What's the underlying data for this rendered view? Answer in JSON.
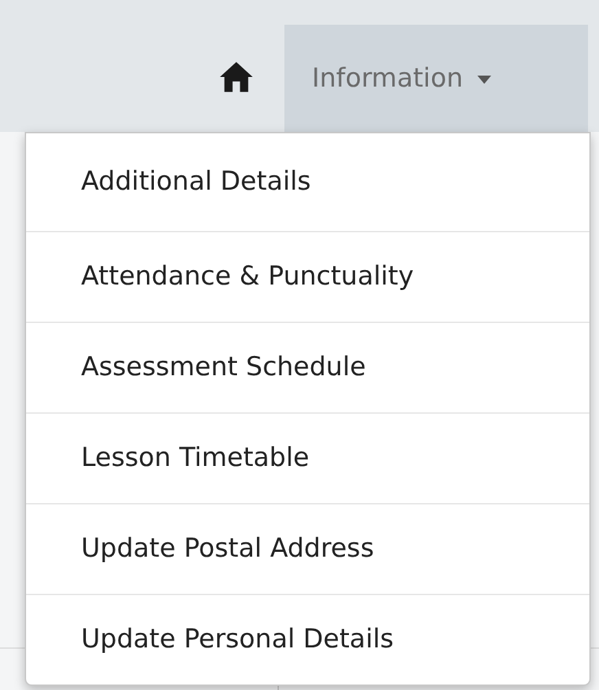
{
  "nav": {
    "tab": {
      "label": "Information",
      "expanded": true
    }
  },
  "menu": {
    "items": [
      {
        "label": "Additional Details"
      },
      {
        "label": "Attendance & Punctuality"
      },
      {
        "label": "Assessment Schedule"
      },
      {
        "label": "Lesson Timetable"
      },
      {
        "label": "Update Postal Address"
      },
      {
        "label": "Update Personal Details"
      }
    ]
  }
}
